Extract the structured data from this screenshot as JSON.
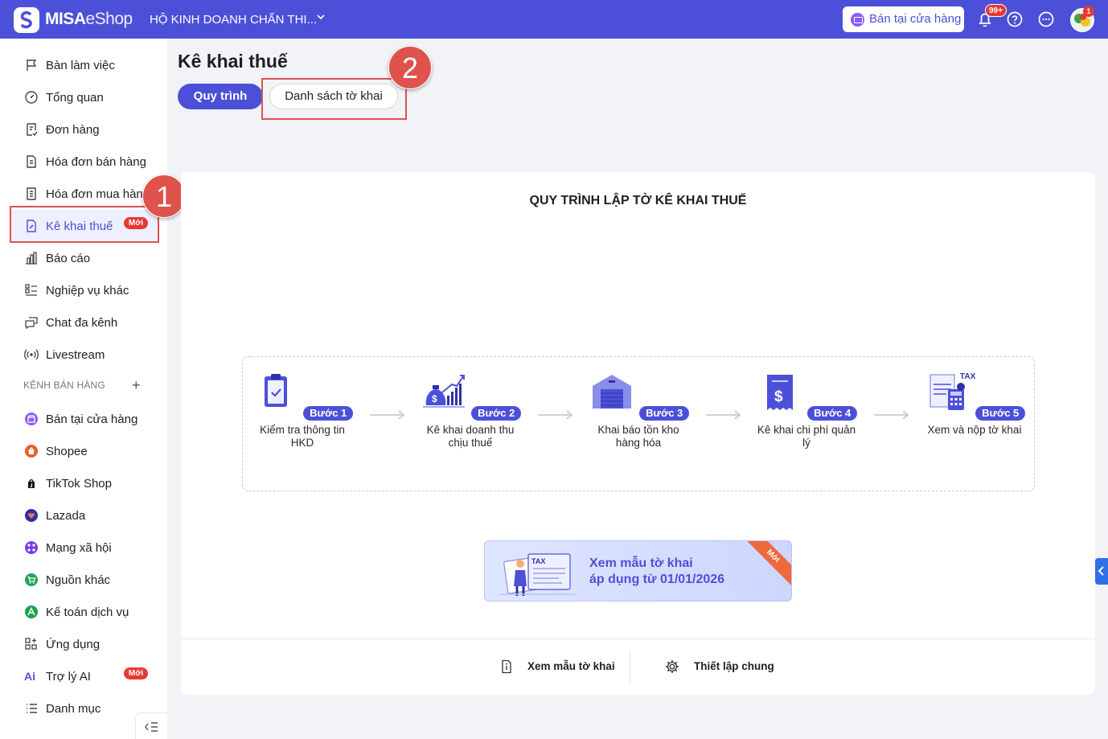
{
  "app": {
    "logo_text_bold": "MISA",
    "logo_text_thin": "eShop",
    "store_name": "HỘ KINH DOANH CHẤN THI..."
  },
  "header": {
    "pos_button": "Bán tại cửa hàng",
    "notification_badge": "99+",
    "avatar_badge": "1"
  },
  "sidebar": {
    "items": [
      {
        "label": "Bàn làm việc",
        "icon": "flag-icon"
      },
      {
        "label": "Tổng quan",
        "icon": "dashboard-icon"
      },
      {
        "label": "Đơn hàng",
        "icon": "order-icon"
      },
      {
        "label": "Hóa đơn bán hàng",
        "icon": "invoice-icon"
      },
      {
        "label": "Hóa đơn mua hàng",
        "icon": "purchase-invoice-icon"
      },
      {
        "label": "Kê khai thuế",
        "icon": "tax-doc-icon",
        "badge": "Mới",
        "active": true
      },
      {
        "label": "Báo cáo",
        "icon": "report-icon"
      },
      {
        "label": "Nghiệp vụ khác",
        "icon": "list-icon"
      },
      {
        "label": "Chat đa kênh",
        "icon": "chat-icon"
      },
      {
        "label": "Livestream",
        "icon": "livestream-icon"
      }
    ],
    "section_label": "KÊNH BÁN HÀNG",
    "channels": [
      {
        "label": "Bán tại cửa hàng",
        "icon": "store-icon",
        "color": "#8b5cf6"
      },
      {
        "label": "Shopee",
        "icon": "shopee-icon",
        "color": "#f05a28"
      },
      {
        "label": "TikTok Shop",
        "icon": "tiktok-icon",
        "color": "#111111"
      },
      {
        "label": "Lazada",
        "icon": "lazada-icon",
        "color": "#2b2fa8"
      },
      {
        "label": "Mạng xã hội",
        "icon": "social-icon",
        "color": "#7c3aed"
      },
      {
        "label": "Nguồn khác",
        "icon": "cart-icon",
        "color": "#22a55a"
      },
      {
        "label": "Kế toán dịch vụ",
        "icon": "accounting-icon",
        "color": "#16a34a"
      },
      {
        "label": "Ứng dụng",
        "icon": "apps-icon",
        "color": "#444444"
      },
      {
        "label": "Trợ lý AI",
        "icon": "ai-icon",
        "color": "#4c50d8",
        "badge": "Mới"
      },
      {
        "label": "Danh mục",
        "icon": "menu-list-icon",
        "color": "#444444"
      }
    ]
  },
  "markers": {
    "one": "1",
    "two": "2"
  },
  "page": {
    "title": "Kê khai thuế",
    "tabs": [
      "Quy trình",
      "Danh sách tờ khai"
    ],
    "card_title": "QUY TRÌNH LẬP TỜ KÊ KHAI THUẾ",
    "steps": [
      {
        "tag": "Bước 1",
        "desc": "Kiểm tra thông tin HKD"
      },
      {
        "tag": "Bước 2",
        "desc": "Kê khai doanh thu chịu thuế"
      },
      {
        "tag": "Bước 3",
        "desc": "Khai báo tồn kho hàng hóa"
      },
      {
        "tag": "Bước 4",
        "desc": "Kê khai chi phí quản lý"
      },
      {
        "tag": "Bước 5",
        "desc": "Xem và nộp tờ khai"
      }
    ],
    "banner": {
      "line1": "Xem mẫu tờ khai",
      "line2": "áp dụng từ 01/01/2026",
      "ribbon": "Mới",
      "tax_label": "TAX"
    },
    "step5_tax_label": "TAX",
    "footer": {
      "view_template": "Xem mẫu tờ khai",
      "settings": "Thiết lập chung"
    }
  }
}
